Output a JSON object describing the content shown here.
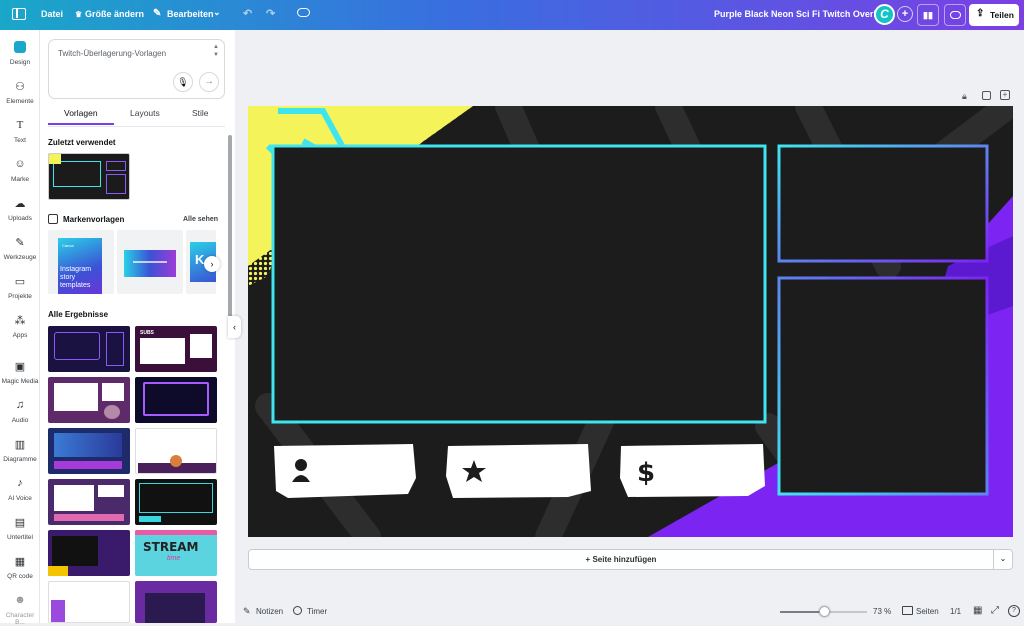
{
  "topbar": {
    "menu_icon": "sidebar-toggle-icon",
    "file": "Datei",
    "resize": "Größe ändern",
    "edit": "Bearbeiten",
    "title": "Purple Black Neon Sci Fi Twitch Overlay",
    "share": "Teilen"
  },
  "rail": [
    "Design",
    "Elemente",
    "Text",
    "Marke",
    "Uploads",
    "Werkzeuge",
    "Projekte",
    "Apps",
    "Magic Media",
    "Audio",
    "Diagramme",
    "AI Voice",
    "Untertitel",
    "QR code",
    "Character B..."
  ],
  "search": {
    "value": "Twitch-Überlagerung-Vorlagen"
  },
  "tabs": [
    "Vorlagen",
    "Layouts",
    "Stile"
  ],
  "recent_title": "Zuletzt verwendet",
  "brand": {
    "title": "Markenvorlagen",
    "see_all": "Alle sehen",
    "card1_brand": "Canva",
    "card1_text": "Instagram story templates"
  },
  "all_results": "Alle Ergebnisse",
  "thumb_texts": {
    "subs": "SUBS",
    "stream": "STREAM",
    "time": "time"
  },
  "add_page": "+ Seite hinzufügen",
  "bottombar": {
    "notes": "Notizen",
    "timer": "Timer",
    "zoom": "73 %",
    "zoom_fraction": 0.73,
    "pages": "Seiten",
    "page_count": "1/1"
  },
  "colors": {
    "accent": "#7b3fe4",
    "cyan": "#3ee5ef",
    "purple": "#7c24f2",
    "yellow": "#f4f45a"
  }
}
